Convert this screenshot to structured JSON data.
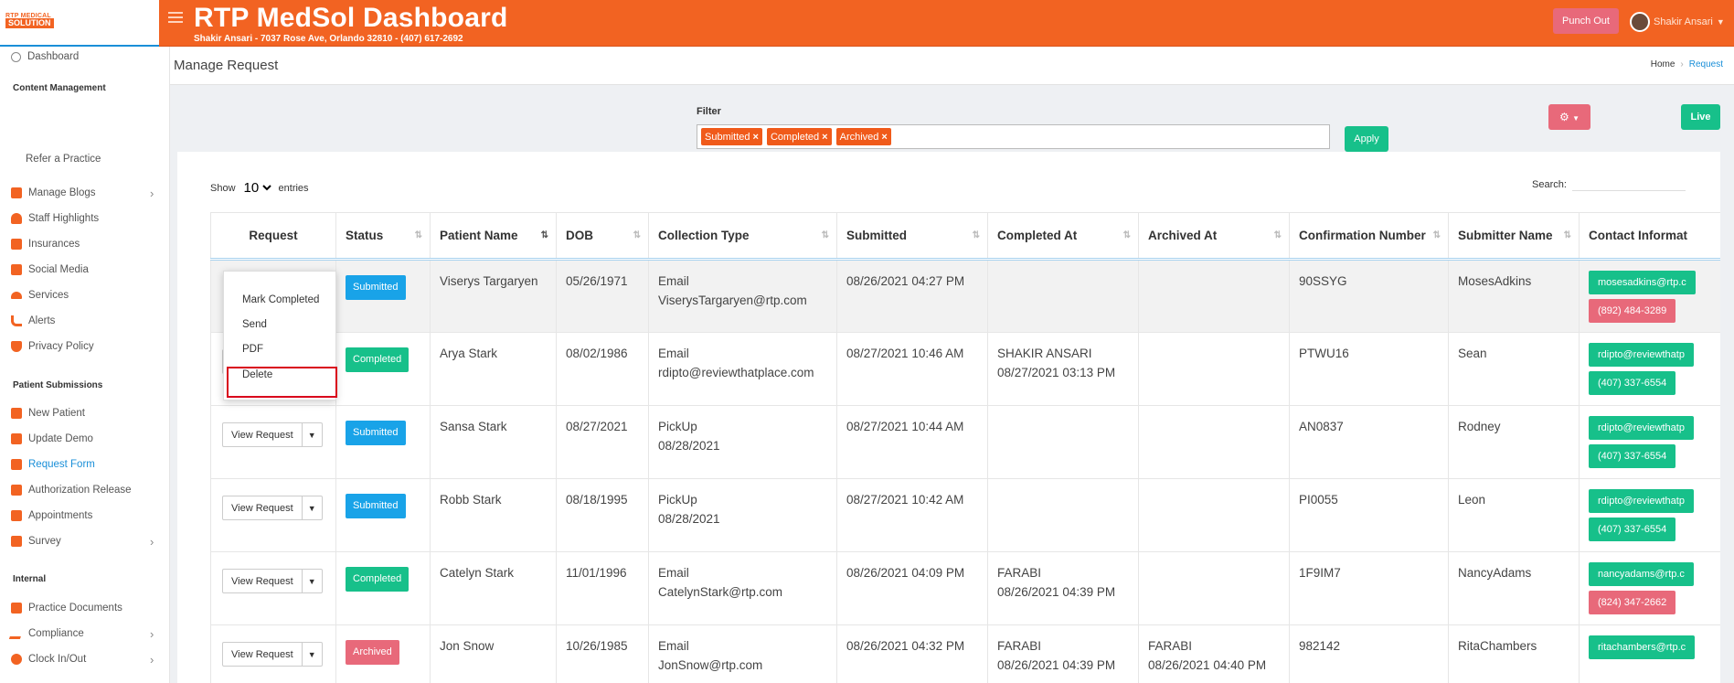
{
  "app": {
    "logo_line1": "RTP MEDICAL",
    "logo_line2": "SOLUTION",
    "title": "RTP MedSol Dashboard",
    "subtitle": "Shakir Ansari - 7037 Rose Ave, Orlando 32810 - (407) 617-2692",
    "punch_out": "Punch Out",
    "user_name": "Shakir Ansari"
  },
  "sidebar": {
    "dashboard": "Dashboard",
    "section_content": "Content Management",
    "refer": "Refer a Practice",
    "content_items": [
      "Manage Blogs",
      "Staff Highlights",
      "Insurances",
      "Social Media",
      "Services",
      "Alerts",
      "Privacy Policy"
    ],
    "section_patient": "Patient Submissions",
    "patient_items": [
      "New Patient",
      "Update Demo",
      "Request Form",
      "Authorization Release",
      "Appointments",
      "Survey"
    ],
    "section_internal": "Internal",
    "internal_items": [
      "Practice Documents",
      "Compliance",
      "Clock In/Out"
    ]
  },
  "page": {
    "title": "Manage Request",
    "breadcrumb_home": "Home",
    "breadcrumb_current": "Request"
  },
  "filter": {
    "label": "Filter",
    "tags": [
      "Submitted",
      "Completed",
      "Archived"
    ],
    "apply": "Apply",
    "live": "Live"
  },
  "table_controls": {
    "show": "Show",
    "entries_value": "10",
    "entries": "entries",
    "search": "Search:"
  },
  "columns": [
    "Request",
    "Status",
    "Patient Name",
    "DOB",
    "Collection Type",
    "Submitted",
    "Completed At",
    "Archived At",
    "Confirmation Number",
    "Submitter Name",
    "Contact Informat"
  ],
  "dropdown": {
    "items": [
      "Mark Completed",
      "Send",
      "PDF",
      "Delete"
    ]
  },
  "view_request": "View Request",
  "rows": [
    {
      "status": "Submitted",
      "name": "Viserys Targaryen",
      "dob": "05/26/1971",
      "type": "Email",
      "type2": "ViserysTargaryen@rtp.com",
      "submitted": "08/26/2021 04:27 PM",
      "completed_by": "",
      "completed_at": "",
      "archived_by": "",
      "archived_at": "",
      "conf": "90SSYG",
      "submitter": "MosesAdkins",
      "email": "mosesadkins@rtp.c",
      "phone": "(892) 484-3289"
    },
    {
      "status": "Completed",
      "name": "Arya Stark",
      "dob": "08/02/1986",
      "type": "Email",
      "type2": "rdipto@reviewthatplace.com",
      "submitted": "08/27/2021 10:46 AM",
      "completed_by": "SHAKIR ANSARI",
      "completed_at": "08/27/2021 03:13 PM",
      "archived_by": "",
      "archived_at": "",
      "conf": "PTWU16",
      "submitter": "Sean",
      "email": "rdipto@reviewthatp",
      "phone": "(407) 337-6554"
    },
    {
      "status": "Submitted",
      "name": "Sansa Stark",
      "dob": "08/27/2021",
      "type": "PickUp",
      "type2": "08/28/2021",
      "submitted": "08/27/2021 10:44 AM",
      "completed_by": "",
      "completed_at": "",
      "archived_by": "",
      "archived_at": "",
      "conf": "AN0837",
      "submitter": "Rodney",
      "email": "rdipto@reviewthatp",
      "phone": "(407) 337-6554"
    },
    {
      "status": "Submitted",
      "name": "Robb Stark",
      "dob": "08/18/1995",
      "type": "PickUp",
      "type2": "08/28/2021",
      "submitted": "08/27/2021 10:42 AM",
      "completed_by": "",
      "completed_at": "",
      "archived_by": "",
      "archived_at": "",
      "conf": "PI0055",
      "submitter": "Leon",
      "email": "rdipto@reviewthatp",
      "phone": "(407) 337-6554"
    },
    {
      "status": "Completed",
      "name": "Catelyn Stark",
      "dob": "11/01/1996",
      "type": "Email",
      "type2": "CatelynStark@rtp.com",
      "submitted": "08/26/2021 04:09 PM",
      "completed_by": "FARABI",
      "completed_at": "08/26/2021 04:39 PM",
      "archived_by": "",
      "archived_at": "",
      "conf": "1F9IM7",
      "submitter": "NancyAdams",
      "email": "nancyadams@rtp.c",
      "phone": "(824) 347-2662"
    },
    {
      "status": "Archived",
      "name": "Jon Snow",
      "dob": "10/26/1985",
      "type": "Email",
      "type2": "JonSnow@rtp.com",
      "submitted": "08/26/2021 04:32 PM",
      "completed_by": "FARABI",
      "completed_at": "08/26/2021 04:39 PM",
      "archived_by": "FARABI",
      "archived_at": "08/26/2021 04:40 PM",
      "conf": "982142",
      "submitter": "RitaChambers",
      "email": "ritachambers@rtp.c",
      "phone": ""
    }
  ]
}
